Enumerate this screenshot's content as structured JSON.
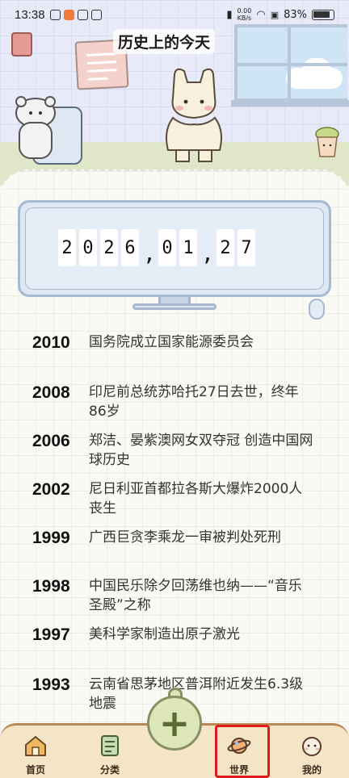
{
  "status_bar": {
    "time": "13:38",
    "net_speed_top": "0.00",
    "net_speed_unit": "KB/s",
    "battery": "83%"
  },
  "header": {
    "title": "历史上的今天"
  },
  "date_display": {
    "digits": [
      "2",
      "0",
      "2",
      "6",
      ",",
      "0",
      "1",
      ",",
      "2",
      "7"
    ]
  },
  "events": [
    {
      "year": "2010",
      "text": "国务院成立国家能源委员会"
    },
    {
      "year": "2008",
      "text": "印尼前总统苏哈托27日去世，终年86岁"
    },
    {
      "year": "2006",
      "text": "郑洁、晏紫澳网女双夺冠 创造中国网球历史"
    },
    {
      "year": "2002",
      "text": "尼日利亚首都拉各斯大爆炸2000人丧生"
    },
    {
      "year": "1999",
      "text": "广西巨贪李乘龙一审被判处死刑"
    },
    {
      "year": "1998",
      "text": "中国民乐除夕回荡维也纳——“音乐圣殿”之称"
    },
    {
      "year": "1997",
      "text": "美科学家制造出原子激光"
    },
    {
      "year": "1993",
      "text": "云南省思茅地区普洱附近发生6.3级地震"
    }
  ],
  "nav": {
    "home": "首页",
    "category": "分类",
    "add": "+",
    "world": "世界",
    "mine": "我的"
  },
  "colors": {
    "highlight": "#e01a1a",
    "nav_bg": "#f3e5c5",
    "fab": "#dde6b8"
  }
}
